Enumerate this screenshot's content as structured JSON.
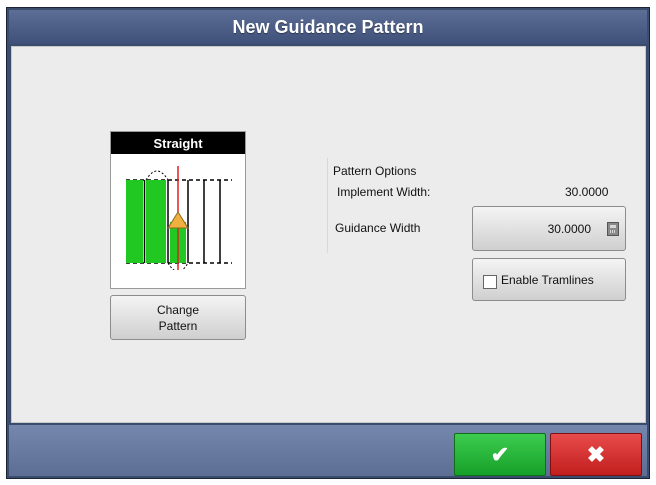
{
  "dialog": {
    "title": "New Guidance Pattern"
  },
  "pattern": {
    "name": "Straight",
    "change_label_line1": "Change",
    "change_label_line2": "Pattern"
  },
  "options": {
    "heading": "Pattern Options",
    "implement_width_label": "Implement Width:",
    "implement_width_value": "30.0000",
    "guidance_width_label": "Guidance Width",
    "guidance_width_value": "30.0000",
    "tramlines_label": "Enable Tramlines",
    "tramlines_checked": false
  },
  "footer": {
    "ok_symbol": "✔",
    "cancel_symbol": "✖"
  },
  "colors": {
    "coverage_green": "#22c822",
    "guidance_red": "#e02020",
    "ok_green": "#22b335",
    "cancel_red": "#d42a2a"
  }
}
